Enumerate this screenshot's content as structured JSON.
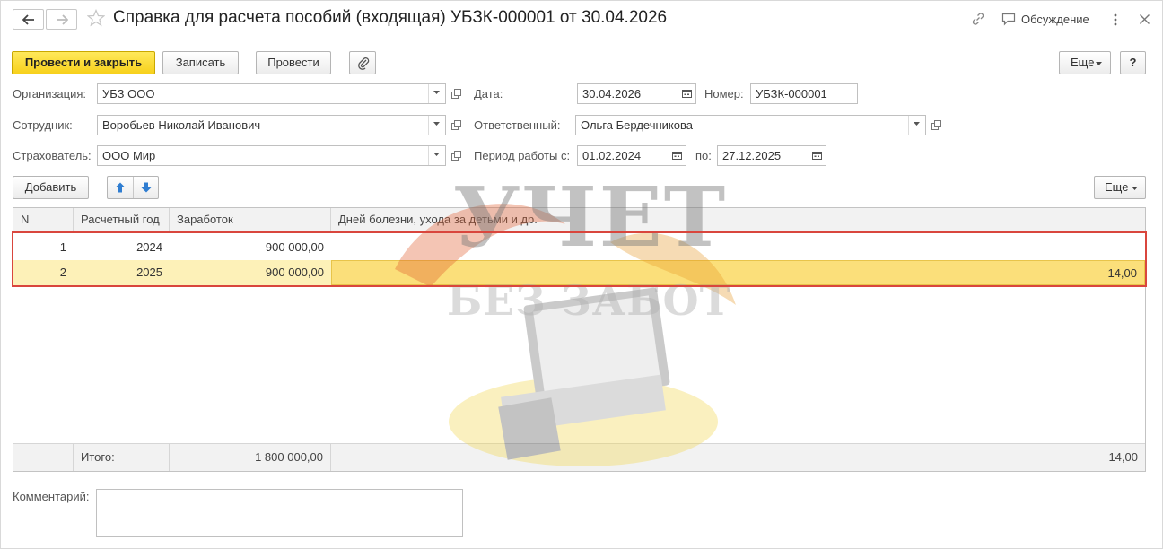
{
  "header": {
    "title": "Справка для расчета пособий (входящая) УБЗК-000001 от 30.04.2026",
    "discussion_label": "Обсуждение"
  },
  "toolbar": {
    "post_close_label": "Провести и закрыть",
    "save_label": "Записать",
    "post_label": "Провести",
    "more_label": "Еще",
    "help_label": "?"
  },
  "form": {
    "organization_label": "Организация:",
    "organization_value": "УБЗ ООО",
    "date_label": "Дата:",
    "date_value": "30.04.2026",
    "number_label": "Номер:",
    "number_value": "УБЗК-000001",
    "employee_label": "Сотрудник:",
    "employee_value": "Воробьев Николай Иванович",
    "responsible_label": "Ответственный:",
    "responsible_value": "Ольга Бердечникова",
    "insurer_label": "Страхователь:",
    "insurer_value": "ООО Мир",
    "period_label": "Период работы с:",
    "period_from": "01.02.2024",
    "period_to_label": "по:",
    "period_to": "27.12.2025"
  },
  "table_toolbar": {
    "add_label": "Добавить",
    "more_label": "Еще"
  },
  "table": {
    "columns": [
      "N",
      "Расчетный год",
      "Заработок",
      "Дней болезни, ухода за детьми и др."
    ],
    "rows": [
      {
        "n": "1",
        "year": "2024",
        "earnings": "900 000,00",
        "days": ""
      },
      {
        "n": "2",
        "year": "2025",
        "earnings": "900 000,00",
        "days": "14,00"
      }
    ],
    "footer": {
      "label": "Итого:",
      "earnings": "1 800 000,00",
      "days": "14,00"
    }
  },
  "comment": {
    "label": "Комментарий:",
    "value": ""
  },
  "watermark": {
    "line1": "УЧЕТ",
    "line2": "БЕЗ ЗАБОТ"
  },
  "colors": {
    "primary_button": "#f7d11c",
    "selected_row": "#fdf1b8",
    "selected_cell": "#fbdf7a",
    "highlight_border": "#d9463d"
  }
}
